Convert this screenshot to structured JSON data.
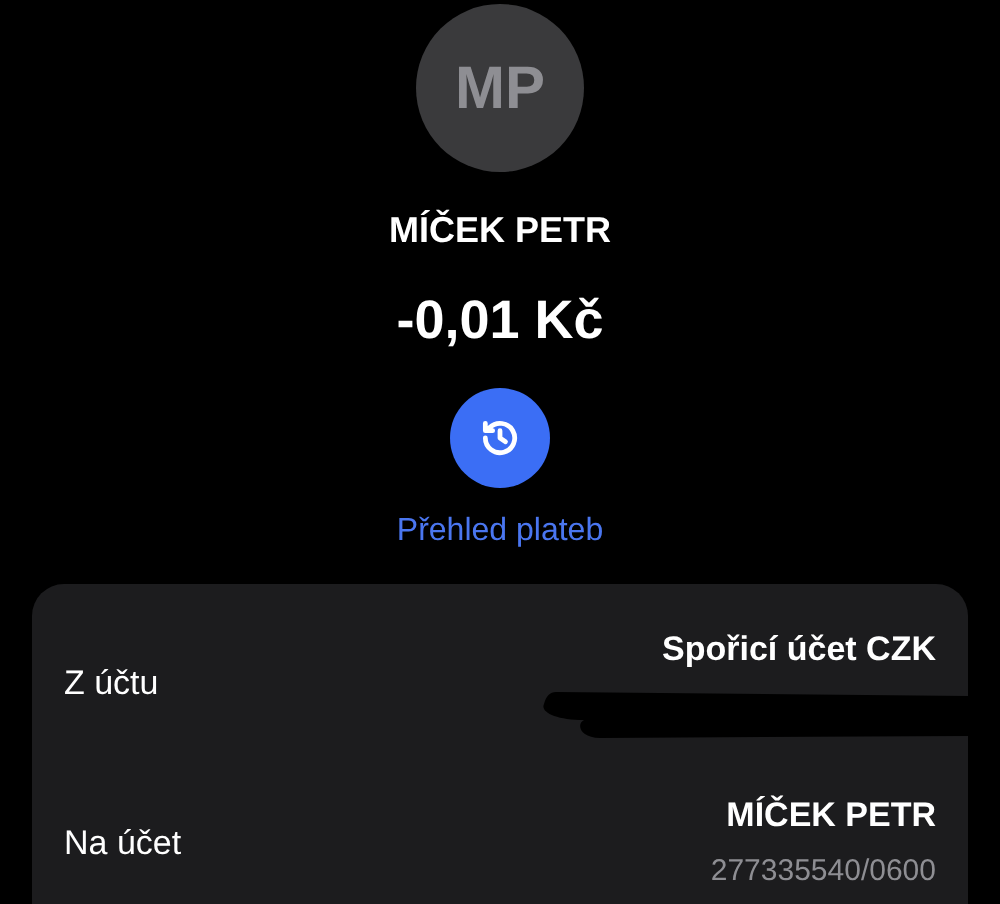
{
  "header": {
    "initials": "MP",
    "name": "MÍČEK PETR",
    "amount": "-0,01 Kč",
    "history_link": "Přehled plateb"
  },
  "details": [
    {
      "kind": "redacted",
      "label": "Z účtu",
      "value": "Spořicí účet CZK"
    },
    {
      "kind": "account",
      "label": "Na účet",
      "value": "MÍČEK PETR",
      "account": "277335540/0600"
    }
  ]
}
